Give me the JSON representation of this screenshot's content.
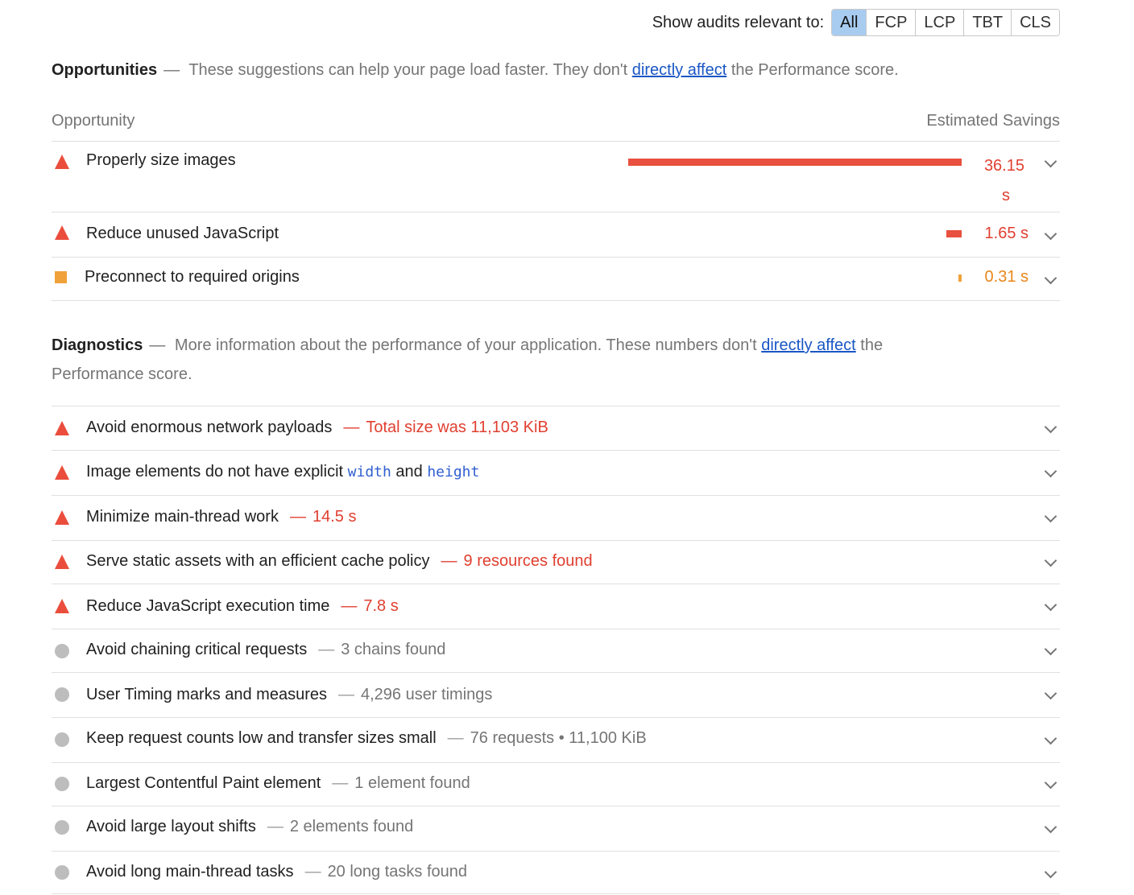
{
  "filter": {
    "label": "Show audits relevant to:",
    "buttons": [
      "All",
      "FCP",
      "LCP",
      "TBT",
      "CLS"
    ],
    "active": "All"
  },
  "opportunities": {
    "title": "Opportunities",
    "dash": "—",
    "desc_before": "These suggestions can help your page load faster. They don't",
    "link": "directly affect",
    "desc_after": "the Performance score.",
    "col_left": "Opportunity",
    "col_right": "Estimated Savings",
    "rows": [
      {
        "label": "Properly size images",
        "saving_num": "36.15",
        "saving_unit": "s",
        "bar_fraction": 1.0,
        "severity": "fail"
      },
      {
        "label": "Reduce unused JavaScript",
        "saving": "1.65 s",
        "bar_fraction": 0.046,
        "severity": "fail"
      },
      {
        "label": "Preconnect to required origins",
        "saving": "0.31 s",
        "bar_fraction": 0.009,
        "severity": "average"
      }
    ]
  },
  "diagnostics": {
    "title": "Diagnostics",
    "dash": "—",
    "desc_before": "More information about the performance of your application. These numbers don't",
    "link": "directly affect",
    "desc_after": "the",
    "desc_line2": "Performance score.",
    "rows": [
      {
        "label": "Avoid enormous network payloads",
        "dash": "—",
        "detail": "Total size was 11,103 KiB",
        "severity": "fail"
      },
      {
        "label_a": "Image elements do not have explicit",
        "code_a": "width",
        "label_b": "and",
        "code_b": "height",
        "severity": "fail"
      },
      {
        "label": "Minimize main-thread work",
        "dash": "—",
        "detail": "14.5 s",
        "severity": "fail"
      },
      {
        "label": "Serve static assets with an efficient cache policy",
        "dash": "—",
        "detail": "9 resources found",
        "severity": "fail"
      },
      {
        "label": "Reduce JavaScript execution time",
        "dash": "—",
        "detail": "7.8 s",
        "severity": "fail"
      },
      {
        "label": "Avoid chaining critical requests",
        "dash": "—",
        "detail": "3 chains found",
        "severity": "info"
      },
      {
        "label": "User Timing marks and measures",
        "dash": "—",
        "detail": "4,296 user timings",
        "severity": "info"
      },
      {
        "label": "Keep request counts low and transfer sizes small",
        "dash": "—",
        "detail": "76 requests • 11,100 KiB",
        "severity": "info"
      },
      {
        "label": "Largest Contentful Paint element",
        "dash": "—",
        "detail": "1 element found",
        "severity": "info"
      },
      {
        "label": "Avoid large layout shifts",
        "dash": "—",
        "detail": "2 elements found",
        "severity": "info"
      },
      {
        "label": "Avoid long main-thread tasks",
        "dash": "—",
        "detail": "20 long tasks found",
        "severity": "info"
      }
    ]
  },
  "colors": {
    "fail": "#eb4d3d",
    "average": "#f0a23a",
    "info": "#bdbdbd",
    "link": "#1a56c4",
    "active_filter": "#a8ccf0"
  }
}
